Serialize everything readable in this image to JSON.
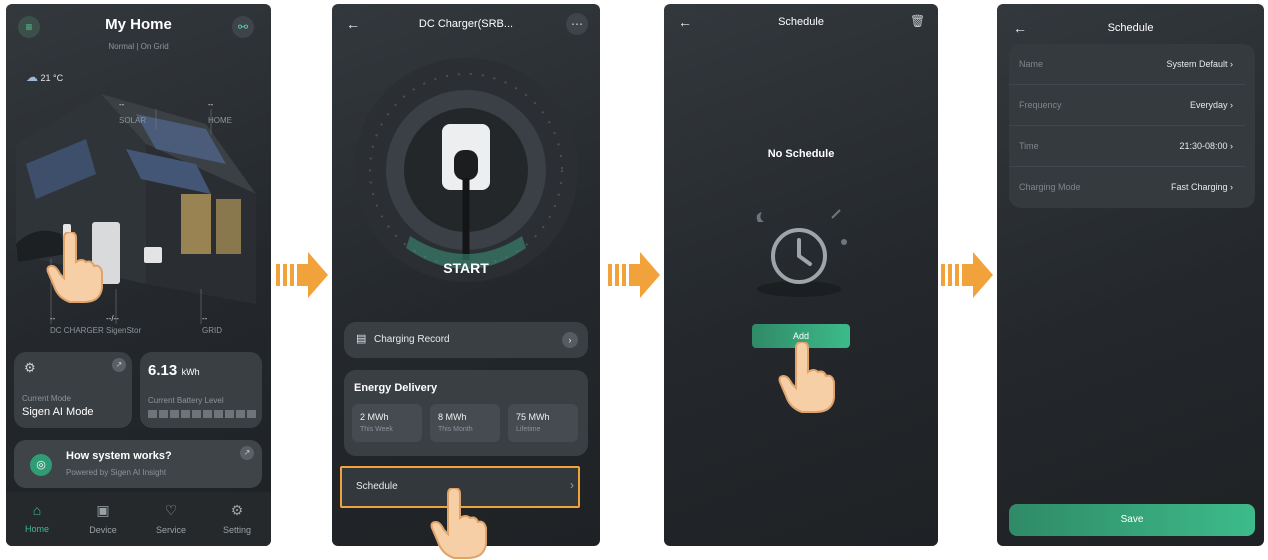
{
  "colors": {
    "accent_green": "#3dbb8a",
    "highlight_orange": "#f2a23a",
    "dark_bg": "#2a2e32"
  },
  "screen1": {
    "title": "My Home",
    "subtitle": "Normal | On Grid",
    "weather": "21 °C",
    "labels": {
      "solar_value": "--",
      "solar": "SOLAR",
      "home_value": "--",
      "home": "HOME",
      "dc_value": "--",
      "dc_charger": "DC CHARGER",
      "sigenstor_value": "--/--",
      "sigenstor": "SigenStor",
      "grid_value": "--",
      "grid": "GRID"
    },
    "mode_card": {
      "caption": "Current Mode",
      "value": "Sigen AI Mode"
    },
    "battery_card": {
      "value": "6.13",
      "unit": "kWh",
      "caption": "Current Battery Level"
    },
    "promo": {
      "title": "How system works?",
      "subtitle": "Powered by Sigen AI Insight"
    },
    "nav": [
      "Home",
      "Device",
      "Service",
      "Setting"
    ]
  },
  "screen2": {
    "title": "DC Charger(SRB...",
    "start": "START",
    "record": "Charging Record",
    "energy_title": "Energy Delivery",
    "stats": [
      {
        "value": "2 MWh",
        "label": "This Week"
      },
      {
        "value": "8 MWh",
        "label": "This Month"
      },
      {
        "value": "75 MWh",
        "label": "Lifetime"
      }
    ],
    "schedule": "Schedule"
  },
  "screen3": {
    "title": "Schedule",
    "empty": "No Schedule",
    "add": "Add"
  },
  "screen4": {
    "title": "Schedule",
    "rows": [
      {
        "key": "Name",
        "value": "System Default"
      },
      {
        "key": "Frequency",
        "value": "Everyday"
      },
      {
        "key": "Time",
        "value": "21:30-08:00"
      },
      {
        "key": "Charging Mode",
        "value": "Fast Charging"
      }
    ],
    "save": "Save"
  }
}
